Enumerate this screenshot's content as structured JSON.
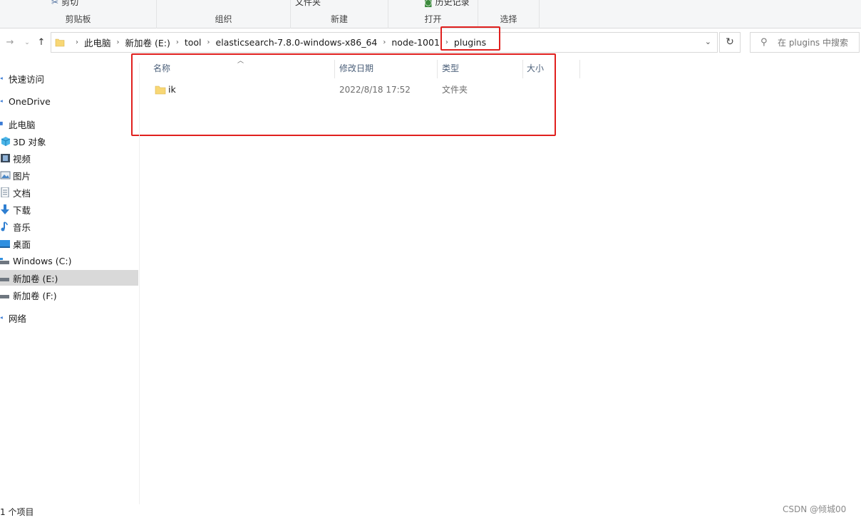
{
  "ribbon": {
    "cut_label": "剪切",
    "groups": [
      "剪贴板",
      "组织",
      "新建",
      "打开",
      "选择"
    ],
    "new_folder_label": "文件夹",
    "history_label": "历史记录"
  },
  "address": {
    "crumbs": [
      "此电脑",
      "新加卷 (E:)",
      "tool",
      "elasticsearch-7.8.0-windows-x86_64",
      "node-1001",
      "plugins"
    ]
  },
  "search": {
    "placeholder": "在 plugins 中搜索"
  },
  "nav": {
    "items": [
      {
        "label": "快速访问",
        "icon": "star-icon"
      },
      {
        "label": "OneDrive",
        "icon": "cloud-icon"
      },
      {
        "label": "此电脑",
        "icon": "computer-icon"
      },
      {
        "label": "3D 对象",
        "icon": "cube-icon"
      },
      {
        "label": "视频",
        "icon": "video-icon"
      },
      {
        "label": "图片",
        "icon": "picture-icon"
      },
      {
        "label": "文档",
        "icon": "document-icon"
      },
      {
        "label": "下载",
        "icon": "download-icon"
      },
      {
        "label": "音乐",
        "icon": "music-icon"
      },
      {
        "label": "桌面",
        "icon": "desktop-icon"
      },
      {
        "label": "Windows (C:)",
        "icon": "drive-icon"
      },
      {
        "label": "新加卷 (E:)",
        "icon": "drive-icon"
      },
      {
        "label": "新加卷 (F:)",
        "icon": "drive-icon"
      },
      {
        "label": "网络",
        "icon": "network-icon"
      }
    ]
  },
  "columns": [
    "名称",
    "修改日期",
    "类型",
    "大小"
  ],
  "files": [
    {
      "name": "ik",
      "modified": "2022/8/18 17:52",
      "type": "文件夹",
      "size": ""
    }
  ],
  "status": {
    "item_count": "1 个项目"
  },
  "watermark": "CSDN @倾城00",
  "colors": {
    "highlight": "#e0201e",
    "folder": "#f8d775",
    "selected": "#d9d9d9",
    "header_text": "#4c607a"
  }
}
